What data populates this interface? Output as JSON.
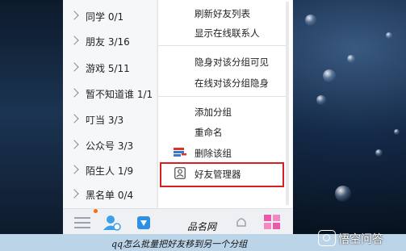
{
  "groups": [
    {
      "label": "同学 0/1"
    },
    {
      "label": "朋友 3/16"
    },
    {
      "label": "游戏 5/11"
    },
    {
      "label": "暂不知道谁 1/1"
    },
    {
      "label": "叮当 3/3"
    },
    {
      "label": "公众号 3/3"
    },
    {
      "label": "陌生人 1/9"
    },
    {
      "label": "黑名单 0/4"
    }
  ],
  "context_menu": {
    "refresh": "刷新好友列表",
    "show_online": "显示在线联系人",
    "invisible_visible": "隐身对该分组可见",
    "online_invisible": "在线对该分组隐身",
    "add_group": "添加分组",
    "rename": "重命名",
    "delete_group": "删除该组",
    "friend_manager": "好友管理器"
  },
  "caption": {
    "line1": "品名网",
    "line2": "qq怎么批量把好友移到另一个分组"
  },
  "watermark": {
    "text": "悟空问答"
  },
  "colors": {
    "highlight": "#d82020",
    "notify_dot": "#ff6a00",
    "accent": "#3aa0e8"
  }
}
